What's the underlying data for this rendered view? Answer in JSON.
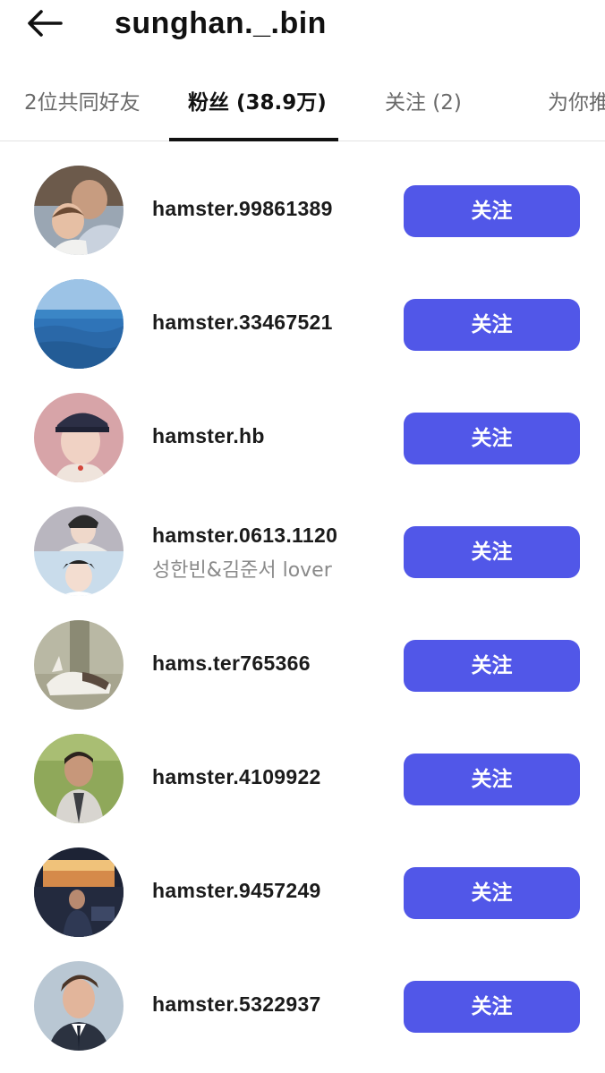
{
  "header": {
    "back_icon": "arrow-left-icon",
    "title": "sunghan._.bin"
  },
  "tabs": [
    {
      "label": "2位共同好友",
      "active": false
    },
    {
      "label": "粉丝 (38.9万)",
      "active": true
    },
    {
      "label": "关注 (2)",
      "active": false
    },
    {
      "label": "为你推",
      "active": false
    }
  ],
  "followers": [
    {
      "username": "hamster.99861389",
      "subtitle": "",
      "button": "关注"
    },
    {
      "username": "hamster.33467521",
      "subtitle": "",
      "button": "关注"
    },
    {
      "username": "hamster.hb",
      "subtitle": "",
      "button": "关注"
    },
    {
      "username": "hamster.0613.1120",
      "subtitle": "성한빈&김준서 lover",
      "button": "关注"
    },
    {
      "username": "hams.ter765366",
      "subtitle": "",
      "button": "关注"
    },
    {
      "username": "hamster.4109922",
      "subtitle": "",
      "button": "关注"
    },
    {
      "username": "hamster.9457249",
      "subtitle": "",
      "button": "关注"
    },
    {
      "username": "hamster.5322937",
      "subtitle": "",
      "button": "关注"
    }
  ],
  "colors": {
    "accent": "#5157e8",
    "text": "#111111",
    "muted": "#6a6a6a"
  }
}
